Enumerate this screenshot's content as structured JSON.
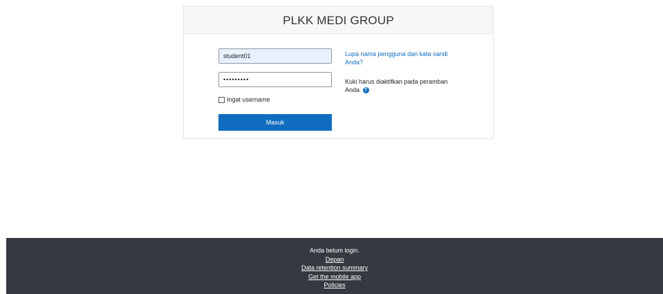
{
  "login": {
    "site_title": "PLKK MEDI GROUP",
    "username_value": "student01",
    "password_value": "•••••••••",
    "remember_label": "Ingat username",
    "submit_label": "Masuk",
    "forgot_link": "Lupa nama pengguna dan kata sandi Anda?",
    "cookies_notice": "Kuki harus diaktifkan pada peramban Anda",
    "help_icon": "question-circle-icon",
    "help_glyph": "?"
  },
  "footer": {
    "status": "Anda belum login.",
    "links": [
      "Depan",
      "Data retention summary",
      "Get the mobile app",
      "Policies"
    ]
  },
  "colors": {
    "brand_blue": "#0f6cbf",
    "footer_bg": "#343a40",
    "autofill_bg": "#e8f0fe"
  }
}
